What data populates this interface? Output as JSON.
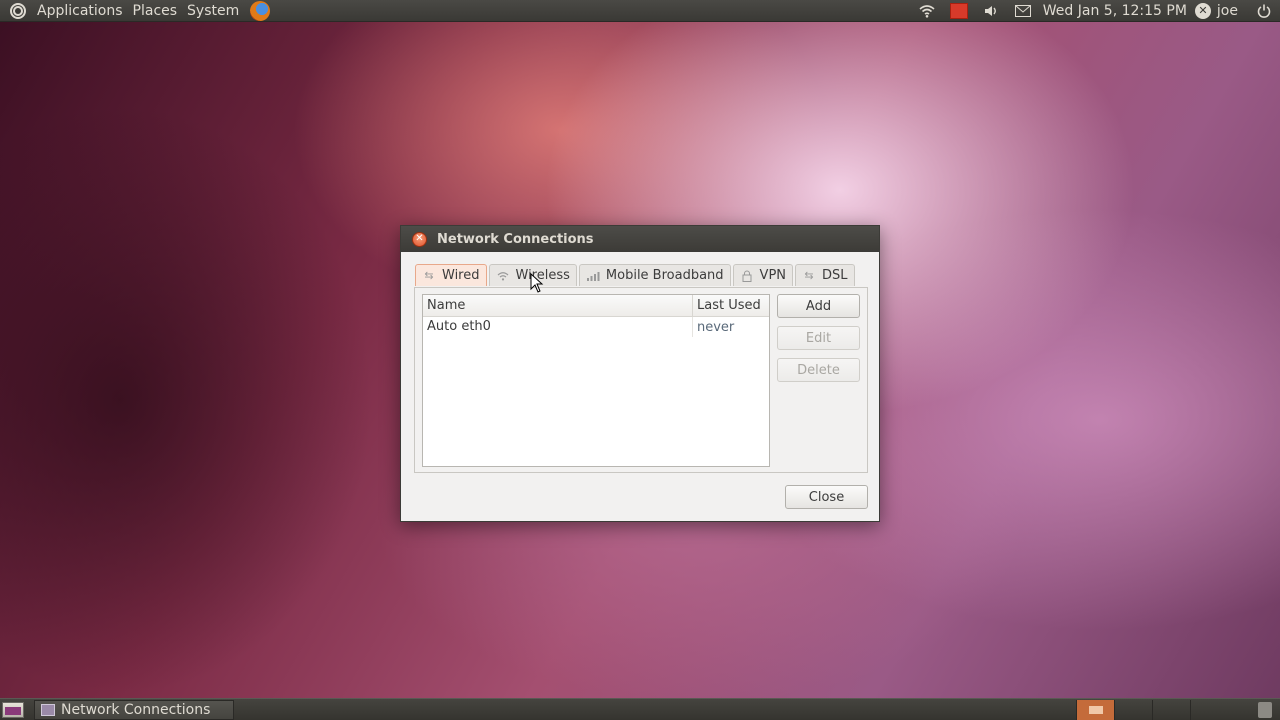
{
  "top_panel": {
    "menus": [
      "Applications",
      "Places",
      "System"
    ],
    "clock": "Wed Jan 5, 12:15 PM",
    "user": "joe"
  },
  "dialog": {
    "title": "Network Connections",
    "tabs": [
      {
        "label": "Wired",
        "icon": "wired-icon",
        "active": true
      },
      {
        "label": "Wireless",
        "icon": "wireless-icon",
        "active": false
      },
      {
        "label": "Mobile Broadband",
        "icon": "mobile-broadband-icon",
        "active": false
      },
      {
        "label": "VPN",
        "icon": "vpn-lock-icon",
        "active": false
      },
      {
        "label": "DSL",
        "icon": "dsl-icon",
        "active": false
      }
    ],
    "columns": {
      "name": "Name",
      "last_used": "Last Used"
    },
    "rows": [
      {
        "name": "Auto eth0",
        "last_used": "never"
      }
    ],
    "buttons": {
      "add": "Add",
      "edit": "Edit",
      "delete": "Delete",
      "close": "Close"
    }
  },
  "taskbar": {
    "window_title": "Network Connections"
  },
  "colors": {
    "panel_bg": "#3c3b37",
    "active_tab": "#fbe7dd",
    "close_button": "#e0502a",
    "workspace_active": "#c46b3a"
  }
}
